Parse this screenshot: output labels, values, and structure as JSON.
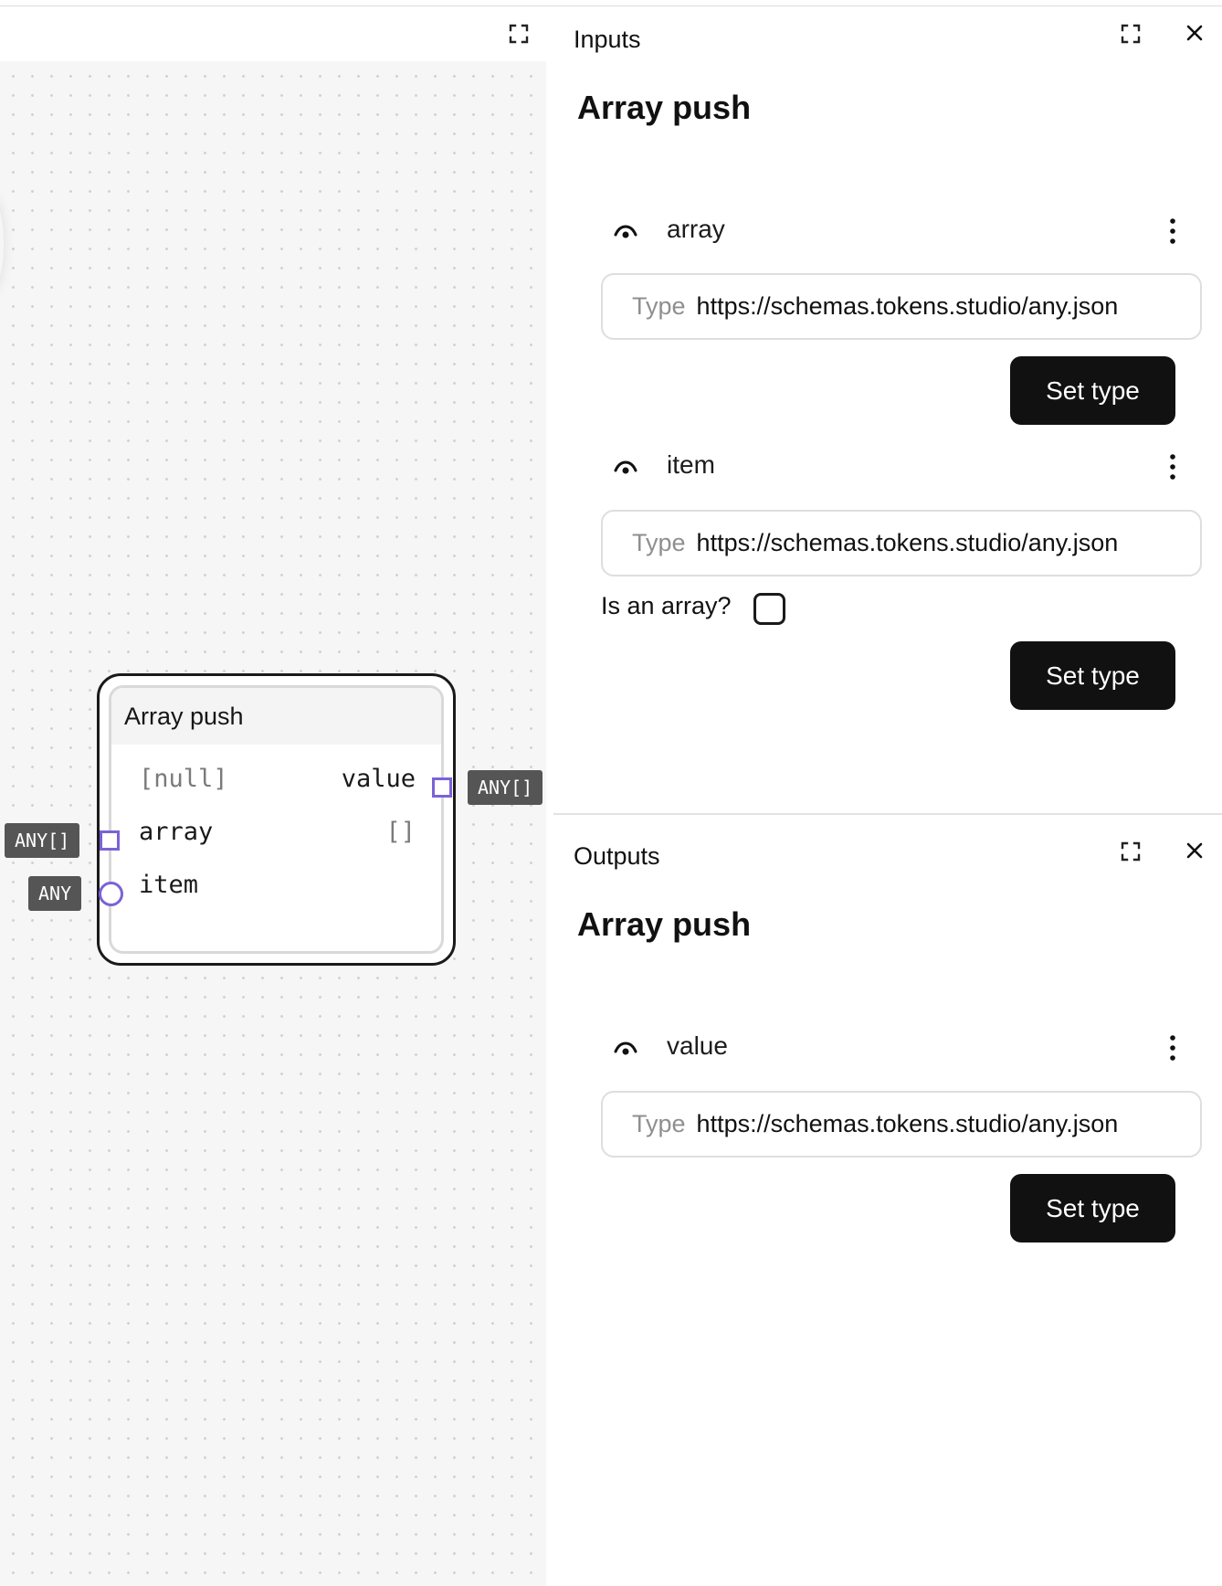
{
  "graph": {
    "node": {
      "title": "Array push",
      "outputs": [
        {
          "value_display": "[null]",
          "name": "value",
          "type": "ANY[]"
        }
      ],
      "inputs": [
        {
          "name": "array",
          "value_display": "[]",
          "type": "ANY[]"
        },
        {
          "name": "item",
          "value_display": "",
          "type": "ANY"
        }
      ]
    }
  },
  "inputs_panel": {
    "label": "Inputs",
    "title": "Array push",
    "ports": [
      {
        "name": "array",
        "type_prefix": "Type",
        "type_value": "https://schemas.tokens.studio/any.json",
        "button": "Set type"
      },
      {
        "name": "item",
        "type_prefix": "Type",
        "type_value": "https://schemas.tokens.studio/any.json",
        "array_label": "Is an array?",
        "is_array": false,
        "button": "Set type"
      }
    ]
  },
  "outputs_panel": {
    "label": "Outputs",
    "title": "Array push",
    "ports": [
      {
        "name": "value",
        "type_prefix": "Type",
        "type_value": "https://schemas.tokens.studio/any.json",
        "button": "Set type"
      }
    ]
  },
  "icons": {
    "expand": "expand-icon",
    "close": "close-icon",
    "visibility": "eye-icon",
    "more": "more-vertical-icon"
  },
  "colors": {
    "port_accent": "#7b62d6",
    "badge_bg": "#555555",
    "button_bg": "#111111"
  }
}
